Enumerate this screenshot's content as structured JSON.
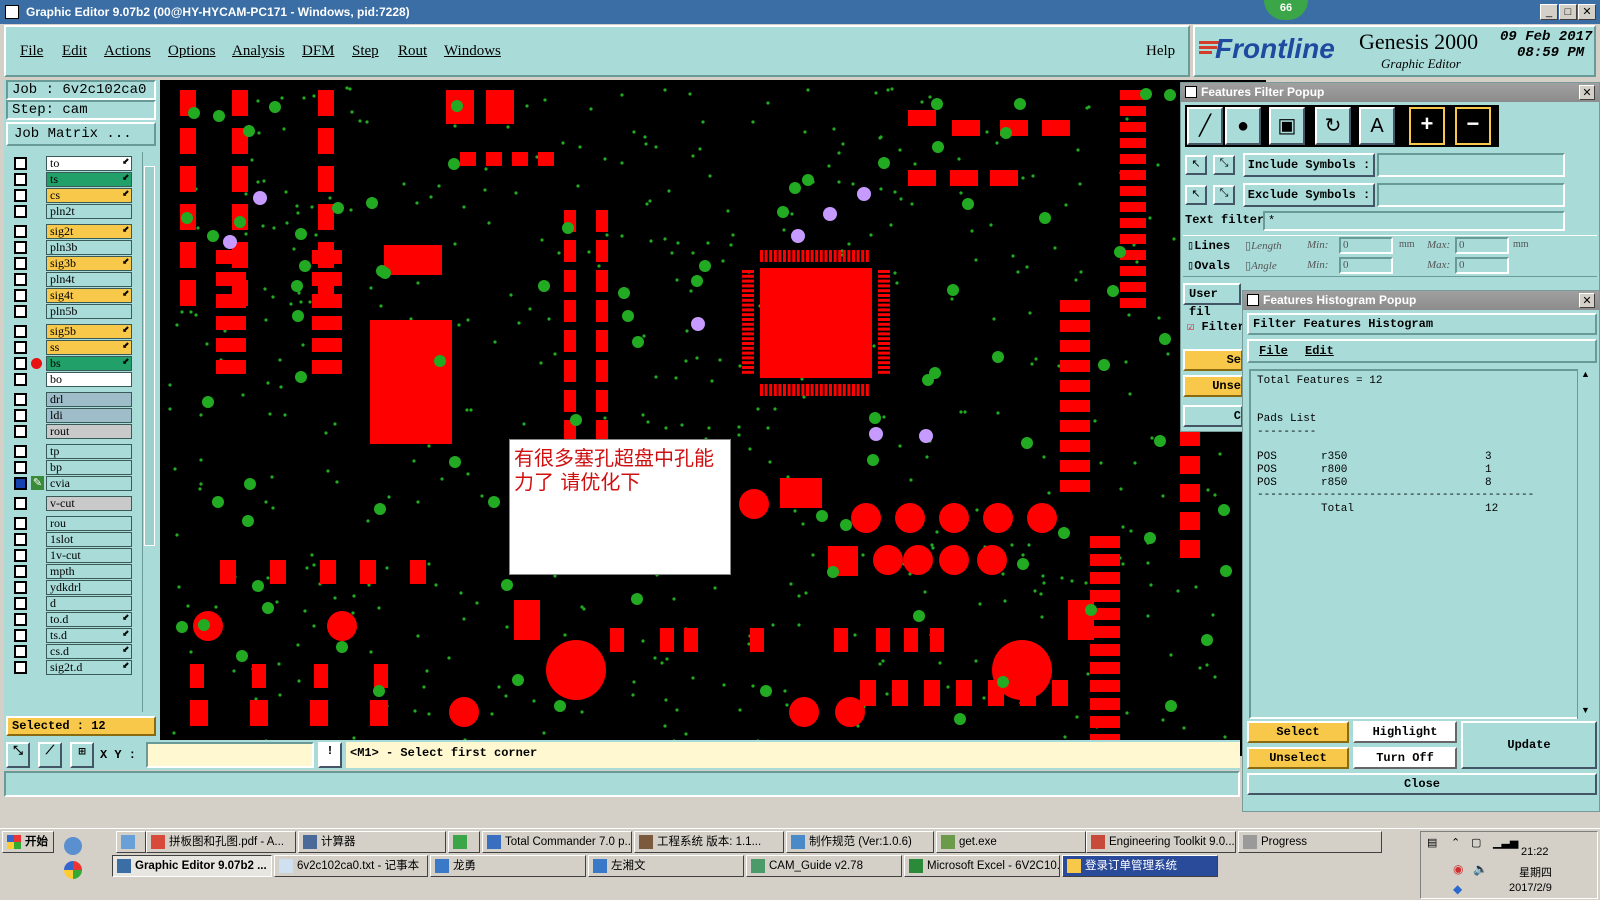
{
  "window": {
    "title": "Graphic Editor 9.07b2 (00@HY-HYCAM-PC171 - Windows, pid:7228)",
    "badge": "66"
  },
  "menu": {
    "items": [
      "File",
      "Edit",
      "Actions",
      "Options",
      "Analysis",
      "DFM",
      "Step",
      "Rout",
      "Windows"
    ],
    "help": "Help"
  },
  "brand": {
    "logo": "Frontline",
    "product": "Genesis 2000",
    "subtitle": "Graphic Editor",
    "date": "09 Feb 2017",
    "time": "08:59 PM"
  },
  "job": {
    "job_label": "Job : 6v2c102ca0",
    "step_label": "Step: cam",
    "matrix_button": "Job Matrix ..."
  },
  "layers": [
    {
      "name": "to",
      "color": "#ffffff",
      "tick": true
    },
    {
      "name": "ts",
      "color": "#22a06a",
      "tick": true
    },
    {
      "name": "cs",
      "color": "#f7c84a",
      "tick": true
    },
    {
      "name": "pln2t",
      "color": "#a9dcd9",
      "tick": false
    },
    {
      "name": "sig2t",
      "color": "#f7c84a",
      "tick": true
    },
    {
      "name": "pln3b",
      "color": "#a9dcd9",
      "tick": false
    },
    {
      "name": "sig3b",
      "color": "#f7c84a",
      "tick": true
    },
    {
      "name": "pln4t",
      "color": "#a9dcd9",
      "tick": false
    },
    {
      "name": "sig4t",
      "color": "#f7c84a",
      "tick": true
    },
    {
      "name": "pln5b",
      "color": "#a9dcd9",
      "tick": false
    },
    {
      "name": "sig5b",
      "color": "#f7c84a",
      "tick": true
    },
    {
      "name": "ss",
      "color": "#f7c84a",
      "tick": true
    },
    {
      "name": "bs",
      "color": "#22a06a",
      "tick": true
    },
    {
      "name": "bo",
      "color": "#ffffff",
      "tick": false
    },
    {
      "name": "drl",
      "color": "#9fbcc9",
      "tick": false
    },
    {
      "name": "ldi",
      "color": "#9fbcc9",
      "tick": false
    },
    {
      "name": "rout",
      "color": "#c9c9c9",
      "tick": false
    },
    {
      "name": "tp",
      "color": "#a9dcd9",
      "tick": false
    },
    {
      "name": "bp",
      "color": "#a9dcd9",
      "tick": false
    },
    {
      "name": "cvia",
      "color": "#a9dcd9",
      "tick": false
    },
    {
      "name": "v-cut",
      "color": "#c9c9c9",
      "tick": false
    },
    {
      "name": "rou",
      "color": "#a9dcd9",
      "tick": false
    },
    {
      "name": "1slot",
      "color": "#a9dcd9",
      "tick": false
    },
    {
      "name": "1v-cut",
      "color": "#a9dcd9",
      "tick": false
    },
    {
      "name": "mpth",
      "color": "#a9dcd9",
      "tick": false
    },
    {
      "name": "ydkdrl",
      "color": "#a9dcd9",
      "tick": false
    },
    {
      "name": "d",
      "color": "#a9dcd9",
      "tick": false
    },
    {
      "name": "to.d",
      "color": "#a9dcd9",
      "tick": true
    },
    {
      "name": "ts.d",
      "color": "#a9dcd9",
      "tick": true
    },
    {
      "name": "cs.d",
      "color": "#a9dcd9",
      "tick": true
    },
    {
      "name": "sig2t.d",
      "color": "#a9dcd9",
      "tick": true
    }
  ],
  "selected_label": "Selected : 12",
  "xy_label": "X Y :",
  "status_message": "<M1> - Select first corner",
  "note_text": "有很多塞孔超盘中孔能力了   请优化下",
  "filter_popup": {
    "title": "Features Filter Popup",
    "include_symbols": "Include Symbols :",
    "exclude_symbols": "Exclude Symbols :",
    "text_filter": "Text filter",
    "text_filter_value": "*",
    "lines": "Lines",
    "ovals": "Ovals",
    "length": "Length",
    "angle": "Angle",
    "min": "Min:",
    "max": "Max:",
    "min_val": "0",
    "max_val": "0",
    "unit": "mm",
    "user_filter": "User fil",
    "filter": "Filter",
    "sel_btn": "Se",
    "unsel_btn": "Unse",
    "c_btn": "C"
  },
  "histogram_popup": {
    "title": "Features Histogram Popup",
    "header": "Filter Features Histogram",
    "menu_file": "File",
    "menu_edit": "Edit",
    "total_features": "Total Features = 12",
    "pads_list": "Pads List",
    "pads_rule": "---------",
    "rows": [
      {
        "type": "POS",
        "symbol": "r350",
        "count": "3"
      },
      {
        "type": "POS",
        "symbol": "r800",
        "count": "1"
      },
      {
        "type": "POS",
        "symbol": "r850",
        "count": "8"
      }
    ],
    "divider": "------------------------------------------",
    "total_label": "Total",
    "total_count": "12",
    "buttons": {
      "select": "Select",
      "highlight": "Highlight",
      "update": "Update",
      "unselect": "Unselect",
      "turn_off": "Turn Off",
      "close": "Close"
    }
  },
  "taskbar": {
    "start": "开始",
    "row1": [
      "拼板图和孔图.pdf - A...",
      "计算器",
      "Total Commander 7.0 p...",
      "工程系统  版本: 1.1...",
      "制作规范 (Ver:1.0.6)",
      "get.exe",
      "Engineering Toolkit 9.0...",
      "Progress"
    ],
    "row2": [
      "Graphic Editor 9.07b2 ...",
      "6v2c102ca0.txt - 记事本",
      "龙勇",
      "左湘文",
      "CAM_Guide v2.78",
      "Microsoft Excel - 6V2C10...",
      "登录订单管理系统"
    ],
    "clock_time": "21:22",
    "clock_day": "星期四",
    "clock_date": "2017/2/9"
  }
}
